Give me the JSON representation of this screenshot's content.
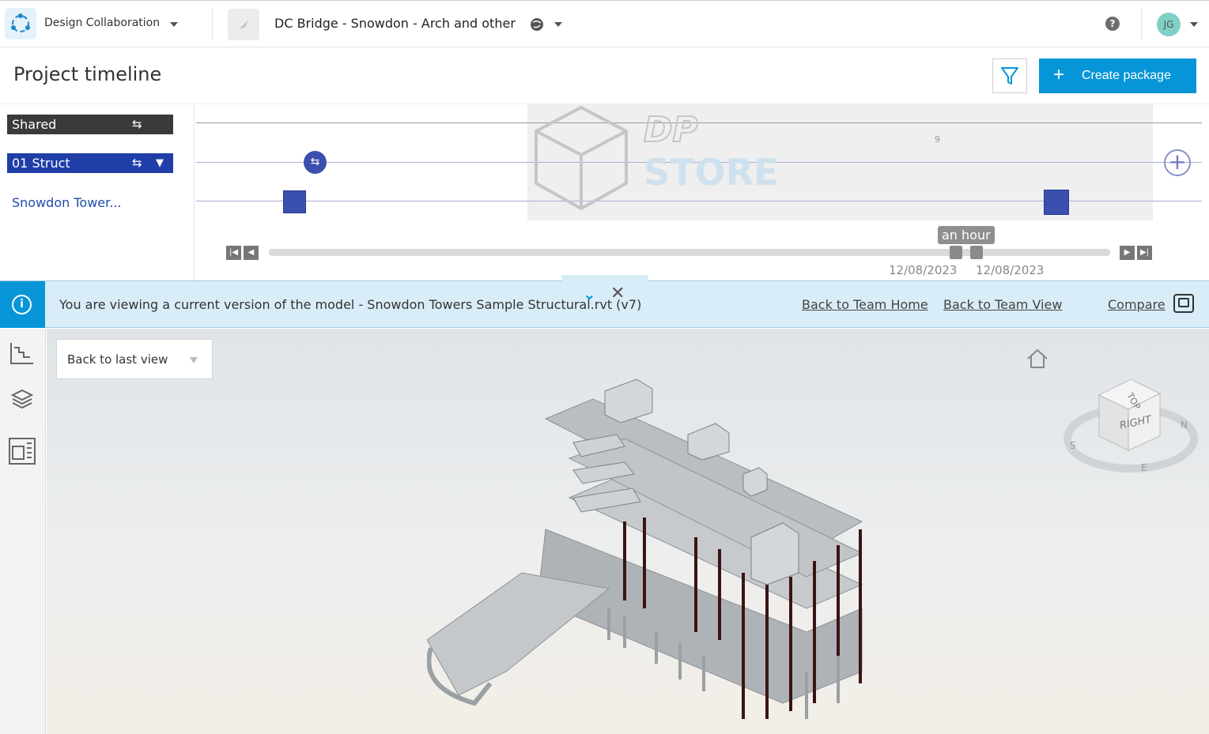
{
  "topbar": {
    "app_name": "Design Collaboration",
    "project_title": "DC Bridge - Snowdon - Arch and other",
    "help_label": "?",
    "user_initials": "JG"
  },
  "header": {
    "title": "Project timeline",
    "create_package_label": "Create package"
  },
  "timeline": {
    "tracks": [
      {
        "label": "Shared"
      },
      {
        "label": "01 Struct"
      }
    ],
    "file_label": "Snowdon Tower...",
    "marker_count_label": "9",
    "tooltip": "an hour",
    "dates": [
      "12/08/2023",
      "12/08/2023"
    ]
  },
  "banner": {
    "message": "You are viewing a current version of the model - Snowdon Towers Sample Structural.rvt (v7)",
    "links": [
      "Back to Team Home",
      "Back to Team View",
      "Compare"
    ]
  },
  "viewer": {
    "back_to_last_view": "Back to last view",
    "viewcube_labels": {
      "top": "TOP",
      "right": "RIGHT",
      "n": "N",
      "s": "S",
      "e": "E"
    }
  },
  "colors": {
    "accent": "#0696d7",
    "track_active": "#1f3ea8",
    "track_shared": "#3a3a3a",
    "marker": "#3a4fae",
    "banner_bg": "#d9edf8"
  },
  "icons": [
    "design-collab-logo-icon",
    "caret-down-icon",
    "project-icon",
    "globe-icon",
    "help-icon",
    "filter-icon",
    "plus-icon",
    "swap-icon",
    "dropdown-icon",
    "add-track-icon",
    "skip-start-icon",
    "step-back-icon",
    "step-forward-icon",
    "skip-end-icon",
    "info-icon",
    "chevron-down-icon",
    "close-icon",
    "compare-icon",
    "model-browser-icon",
    "layers-icon",
    "sheets-icon",
    "home-icon"
  ]
}
